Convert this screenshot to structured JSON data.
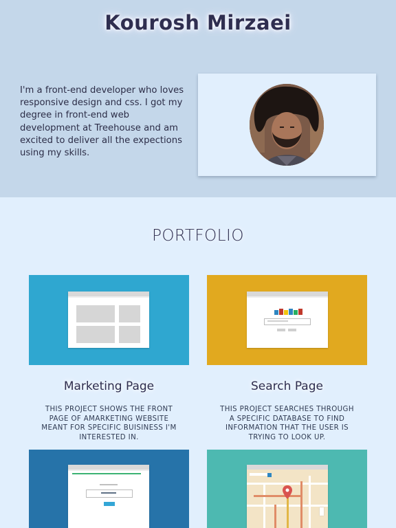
{
  "header": {
    "name": "Kourosh Mirzaei",
    "bio": "I'm a front-end developer who loves responsive design and css. I got my degree in front-end web development at Treehouse and am excited to deliver all the expections using my skills."
  },
  "portfolio": {
    "heading": "PORTFOLIO",
    "projects": [
      {
        "title": "Marketing Page",
        "desc_lines": [
          "This project shows the front",
          "page of amarketing website",
          "meant for specific buisiness I'm",
          "interested in."
        ],
        "color": "#2fa7d0",
        "icon": "website-layout-icon"
      },
      {
        "title": "Search Page",
        "desc_lines": [
          "This project searches through",
          "a specific database to find",
          "information that the user is",
          "trying to look up."
        ],
        "color": "#e1a91f",
        "icon": "search-page-icon"
      },
      {
        "title": "",
        "desc_lines": [],
        "color": "#2673a9",
        "icon": "login-form-icon"
      },
      {
        "title": "",
        "desc_lines": [],
        "color": "#4db9b1",
        "icon": "map-icon"
      }
    ]
  }
}
